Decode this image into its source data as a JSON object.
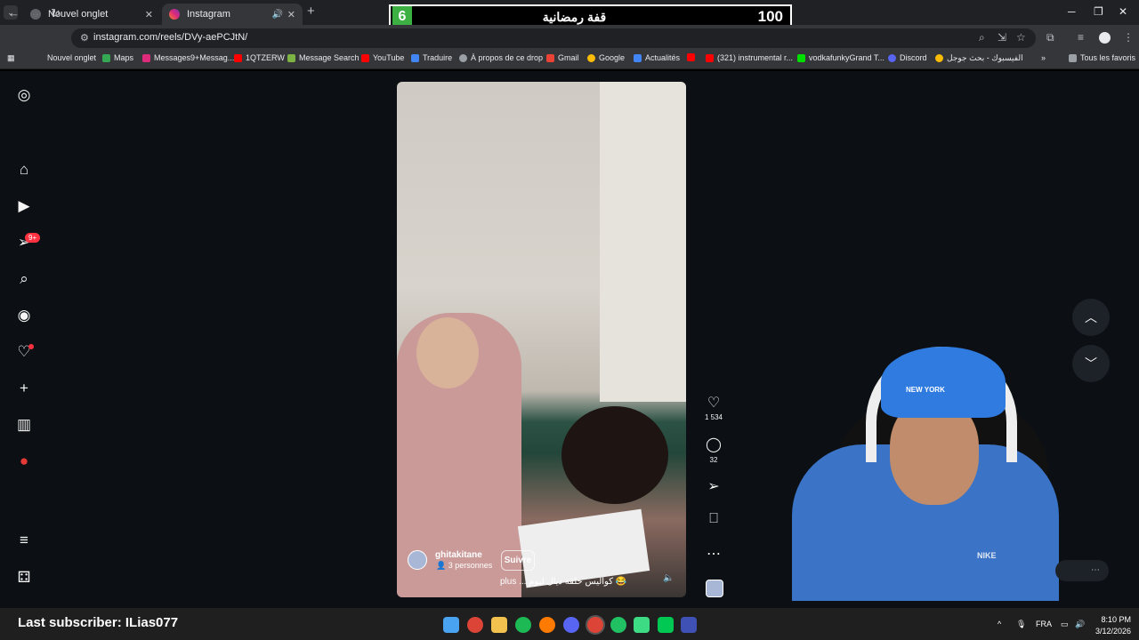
{
  "browser": {
    "tabs": [
      {
        "label": "Nouvel onglet",
        "favicon": "chrome-icon"
      },
      {
        "label": "Instagram",
        "favicon": "instagram-icon",
        "active": true
      }
    ],
    "url": "instagram.com/reels/DVy-aePCJtN/",
    "bookmarks": [
      "Nouvel onglet",
      "Maps",
      "Messages9+Messag...",
      "1QTZERW",
      "Message Search",
      "YouTube",
      "Traduire",
      "À propos de ce drop",
      "Gmail",
      "Google",
      "Actualités",
      "(321) instrumental r...",
      "vodkafunkyGrand T...",
      "Discord",
      "الفيسبوك - بحث جوجل",
      "Tous les favoris"
    ]
  },
  "overlay": {
    "number": "6",
    "title": "قفة رمضانية",
    "score": "100",
    "accent": "#3cb043"
  },
  "sidebar": {
    "notification_badge": "9+"
  },
  "reel": {
    "username": "ghitakitane",
    "people": "3 personnes",
    "follow_label": "Suivre",
    "caption_more": "plus ...",
    "caption": "كواليس حلقة ديال ليوم 😂",
    "likes": "1 534",
    "comments": "32"
  },
  "webcam": {
    "cap_text": "NEW YORK",
    "jacket_logo": "NIKE"
  },
  "stream": {
    "last_subscriber": "Last subscriber: ILias077"
  },
  "taskbar": {
    "language": "FRA",
    "time": "8:10 PM",
    "date": "3/12/2026"
  },
  "colors": {
    "ig_background": "#0c1014",
    "chrome_dark": "#202124",
    "badge_red": "#ff3040"
  }
}
